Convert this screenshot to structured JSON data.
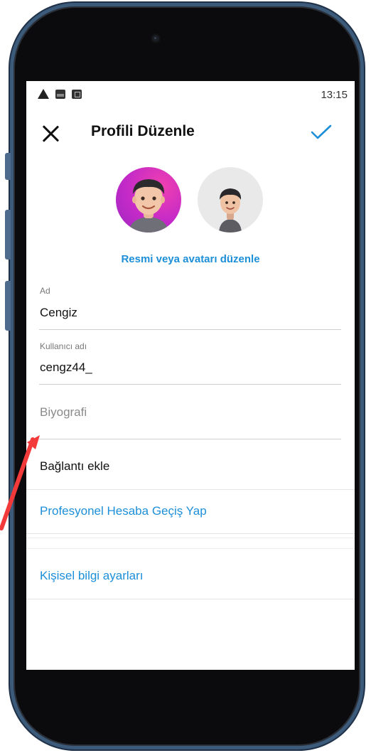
{
  "status_bar": {
    "time": "13:15",
    "icons": [
      "warning-icon",
      "image-icon",
      "app-icon"
    ]
  },
  "header": {
    "title": "Profili Düzenle",
    "close_icon": "close-icon",
    "done_icon": "checkmark-icon"
  },
  "avatars": {
    "edit_link": "Resmi veya avatarı düzenle"
  },
  "fields": {
    "name": {
      "label": "Ad",
      "value": "Cengiz"
    },
    "username": {
      "label": "Kullanıcı adı",
      "value": "cengz44_"
    },
    "bio": {
      "placeholder": "Biyografi"
    }
  },
  "rows": {
    "add_link": "Bağlantı ekle",
    "professional": "Profesyonel Hesaba Geçiş Yap",
    "personal_info": "Kişisel bilgi ayarları"
  },
  "colors": {
    "accent": "#1d8fd8",
    "phone_frame": "#3c5a7a",
    "annotation_arrow": "#f23a3a"
  }
}
